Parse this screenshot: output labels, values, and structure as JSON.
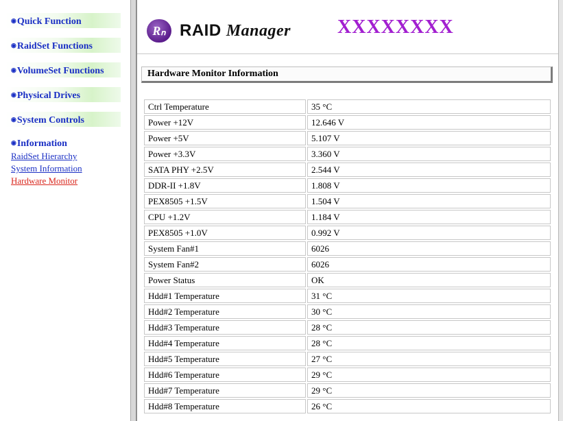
{
  "nav": {
    "items": [
      {
        "label": "Quick Function"
      },
      {
        "label": "RaidSet Functions"
      },
      {
        "label": "VolumeSet Functions"
      },
      {
        "label": "Physical Drives"
      },
      {
        "label": "System Controls"
      }
    ],
    "information": {
      "title": "Information",
      "links": [
        {
          "label": "RaidSet Hierarchy"
        },
        {
          "label": "System Information"
        },
        {
          "label": "Hardware Monitor"
        }
      ]
    }
  },
  "header": {
    "logo_badge": "Rₙ",
    "logo_word": "RAID",
    "logo_script": "Manager",
    "device_name": "XXXXXXXX"
  },
  "monitor": {
    "title": "Hardware Monitor Information",
    "rows": [
      {
        "label": "Ctrl Temperature",
        "value": "35 °C"
      },
      {
        "label": "Power +12V",
        "value": "12.646 V"
      },
      {
        "label": "Power +5V",
        "value": "5.107 V"
      },
      {
        "label": "Power +3.3V",
        "value": "3.360 V"
      },
      {
        "label": "SATA PHY +2.5V",
        "value": "2.544 V"
      },
      {
        "label": "DDR-II +1.8V",
        "value": "1.808 V"
      },
      {
        "label": "PEX8505 +1.5V",
        "value": "1.504 V"
      },
      {
        "label": "CPU +1.2V",
        "value": "1.184 V"
      },
      {
        "label": "PEX8505 +1.0V",
        "value": "0.992 V"
      },
      {
        "label": "System Fan#1",
        "value": "6026"
      },
      {
        "label": "System Fan#2",
        "value": "6026"
      },
      {
        "label": "Power Status",
        "value": "OK"
      },
      {
        "label": "Hdd#1 Temperature",
        "value": "31 °C"
      },
      {
        "label": "Hdd#2 Temperature",
        "value": "30 °C"
      },
      {
        "label": "Hdd#3 Temperature",
        "value": "28 °C"
      },
      {
        "label": "Hdd#4 Temperature",
        "value": "28 °C"
      },
      {
        "label": "Hdd#5 Temperature",
        "value": "27 °C"
      },
      {
        "label": "Hdd#6 Temperature",
        "value": "29 °C"
      },
      {
        "label": "Hdd#7 Temperature",
        "value": "29 °C"
      },
      {
        "label": "Hdd#8 Temperature",
        "value": "26 °C"
      }
    ]
  },
  "colors": {
    "nav_link": "#1a2fc4",
    "nav_link_active": "#d9261c",
    "device_name": "#a21fd0",
    "logo_badge": "#5b1d8c"
  }
}
